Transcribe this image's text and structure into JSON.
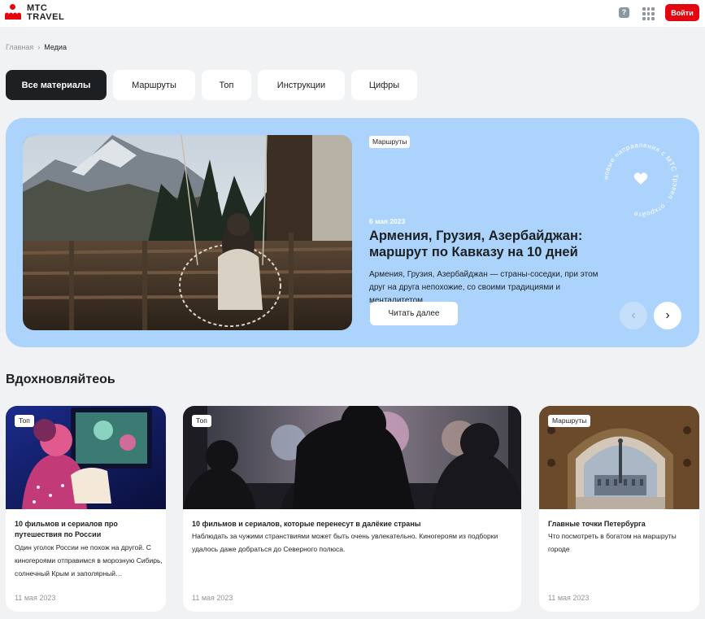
{
  "header": {
    "logo_line1": "МТС",
    "logo_line2": "TRAVEL",
    "help_glyph": "?",
    "login_label": "Войти",
    "brand_color": "#e30611"
  },
  "breadcrumb": {
    "home": "Главная",
    "separator": "›",
    "current": "Медиа"
  },
  "tabs": [
    {
      "label": "Все материалы",
      "active": true
    },
    {
      "label": "Маршруты",
      "active": false
    },
    {
      "label": "Топ",
      "active": false
    },
    {
      "label": "Инструкции",
      "active": false
    },
    {
      "label": "Цифры",
      "active": false
    }
  ],
  "hero": {
    "badge": "Маршруты",
    "date": "6 мая 2023",
    "title": "Армения, Грузия, Азербайджан: маршрут по Кавказу на 10 дней",
    "description": "Армения, Грузия, Азербайджан — страны-соседки, при этом друг на друга непохожие, со своими традициями и менталитетом.",
    "read_more": "Читать далее",
    "prev_glyph": "‹",
    "next_glyph": "›",
    "stamp_text": "новые направления с МТС Трэвел · откройте ",
    "background": "#acd3fb"
  },
  "section": {
    "title": "Вдохновляйтеоь"
  },
  "cards": [
    {
      "badge": "Топ",
      "title": "10 фильмов и сериалов про путешествия по России",
      "description": "Один уголок России не похож на другой. С киногероями отправимся в морозную Сибирь, солнечный Крым и заполярный…",
      "date": "11 мая 2023"
    },
    {
      "badge": "Топ",
      "title": "10 фильмов и сериалов, которые перенесут в далёкие страны",
      "description": "Наблюдать за чужими странствиями может быть очень увлекательно. Киногероям из подборки удалось даже добраться до Северного полюса.",
      "date": "11 мая 2023"
    },
    {
      "badge": "Маршруты",
      "title": "Главные точки Петербурга",
      "description": "Что посмотреть в богатом на маршруты городе",
      "date": "11 мая 2023"
    }
  ]
}
